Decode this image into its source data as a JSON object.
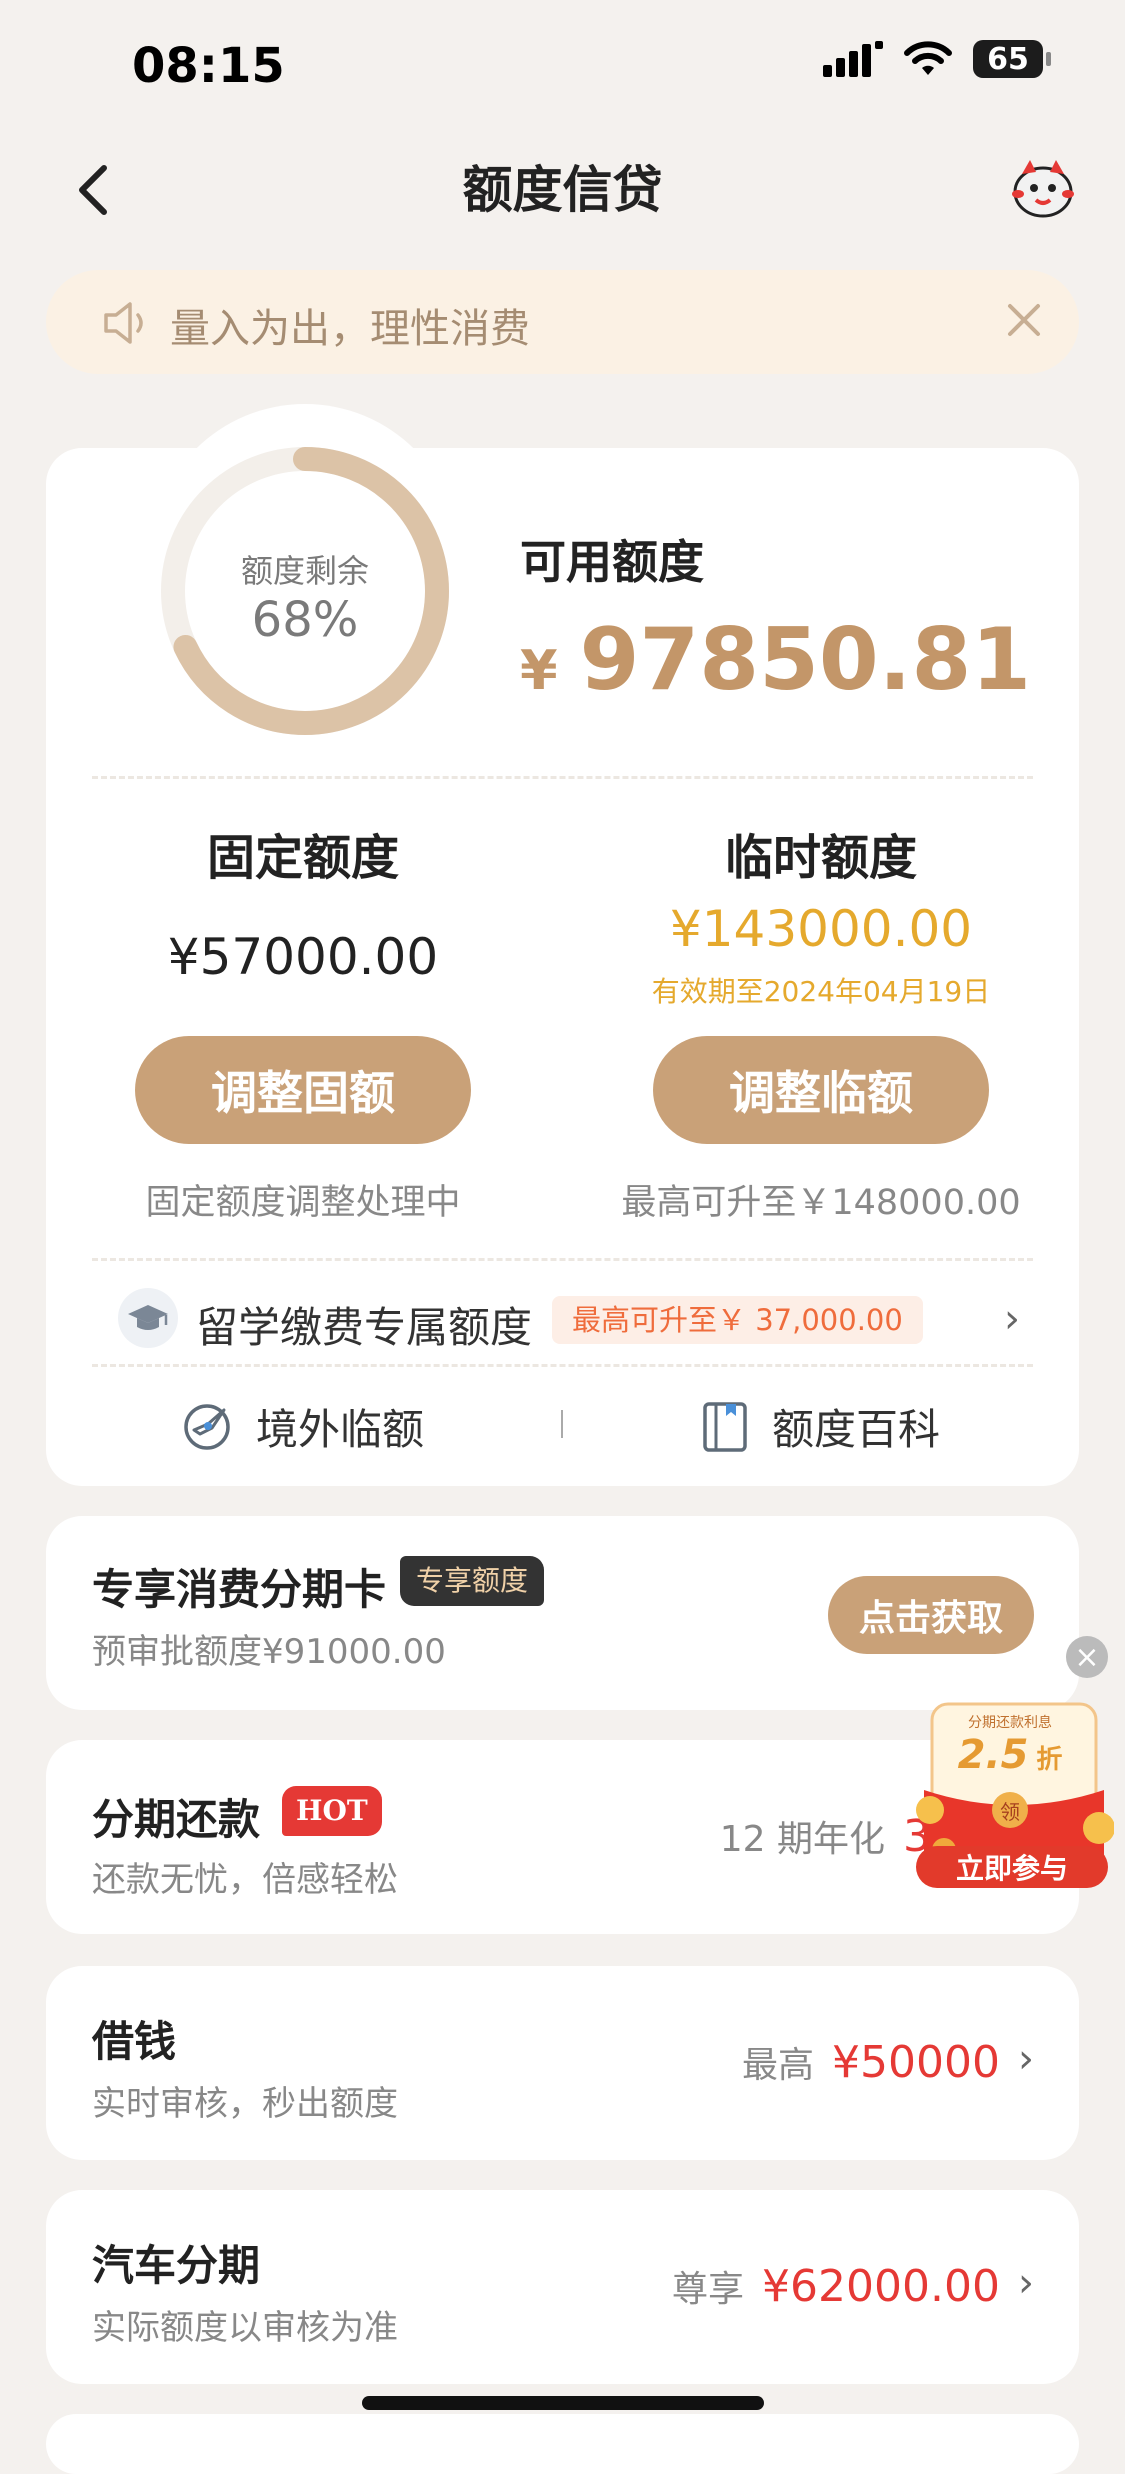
{
  "status_bar": {
    "time": "08:15",
    "battery": "65"
  },
  "header": {
    "title": "额度信贷"
  },
  "notice": {
    "text": "量入为出，理性消费"
  },
  "credit_summary": {
    "ring_label": "额度剩余",
    "ring_percent_text": "68%",
    "ring_fraction": 0.68,
    "available_label": "可用额度",
    "currency_symbol": "¥",
    "available_value": "97850.81"
  },
  "fixed_limit": {
    "title": "固定额度",
    "value": "¥57000.00",
    "button_label": "调整固额",
    "note": "固定额度调整处理中"
  },
  "temp_limit": {
    "title": "临时额度",
    "value": "¥143000.00",
    "validity": "有效期至2024年04月19日",
    "button_label": "调整临额",
    "note": "最高可升至￥148000.00"
  },
  "study_abroad": {
    "label": "留学缴费专属额度",
    "badge": "最高可升至￥ 37,000.00"
  },
  "tools": [
    {
      "label": "境外临额",
      "icon": "overseas-icon"
    },
    {
      "label": "额度百科",
      "icon": "book-icon"
    }
  ],
  "installment_card": {
    "title": "专享消费分期卡",
    "badge": "专享额度",
    "subtitle": "预审批额度¥91000.00",
    "button_label": "点击获取"
  },
  "installment_repay": {
    "title": "分期还款",
    "badge": "HOT",
    "subtitle": "还款无忧，倍感轻松",
    "right_label": "12 期年化",
    "right_value": "3."
  },
  "borrow": {
    "title": "借钱",
    "subtitle": "实时审核，秒出额度",
    "right_label": "最高",
    "right_value": "¥50000"
  },
  "car_loan": {
    "title": "汽车分期",
    "subtitle": "实际额度以审核为准",
    "right_label": "尊享",
    "right_value": "¥62000.00"
  },
  "promo": {
    "top_text": "分期还款利息",
    "discount": "2.5",
    "discount_unit": "折",
    "coin_text": "领",
    "button_label": "立即参与"
  },
  "colors": {
    "accent": "#c9a178",
    "gold_text": "#c39669",
    "orange": "#e5a92d",
    "red": "#e53935"
  }
}
